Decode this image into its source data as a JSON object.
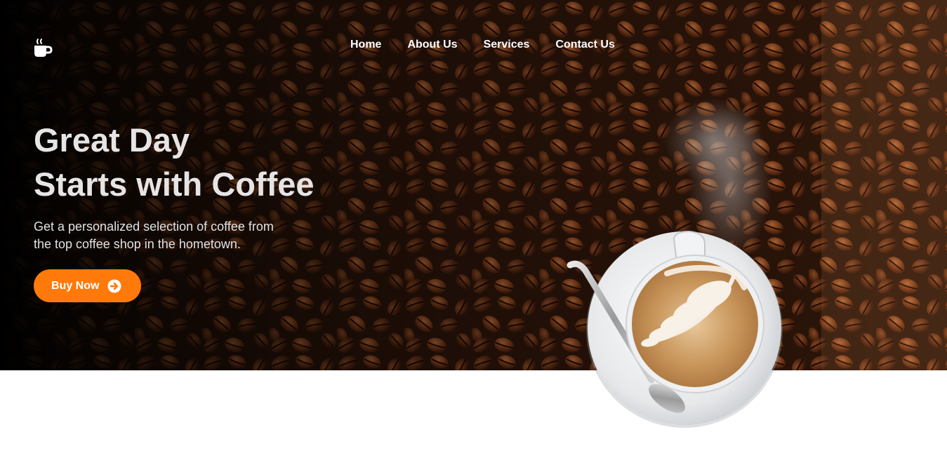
{
  "logo": {
    "icon": "coffee-cup-icon"
  },
  "nav": {
    "items": [
      {
        "label": "Home"
      },
      {
        "label": "About Us"
      },
      {
        "label": "Services"
      },
      {
        "label": "Contact Us"
      }
    ]
  },
  "hero": {
    "headline_line1": "Great Day",
    "headline_line2": "Starts with Coffee",
    "subtext_line1": "Get a personalized selection of coffee from",
    "subtext_line2": "the top coffee shop in the hometown.",
    "cta": {
      "label": "Buy Now",
      "icon": "arrow-circle-right-icon",
      "color": "#ff7a0a"
    }
  },
  "colors": {
    "accent": "#ff7a0a",
    "headline": "#e6e4e4"
  }
}
